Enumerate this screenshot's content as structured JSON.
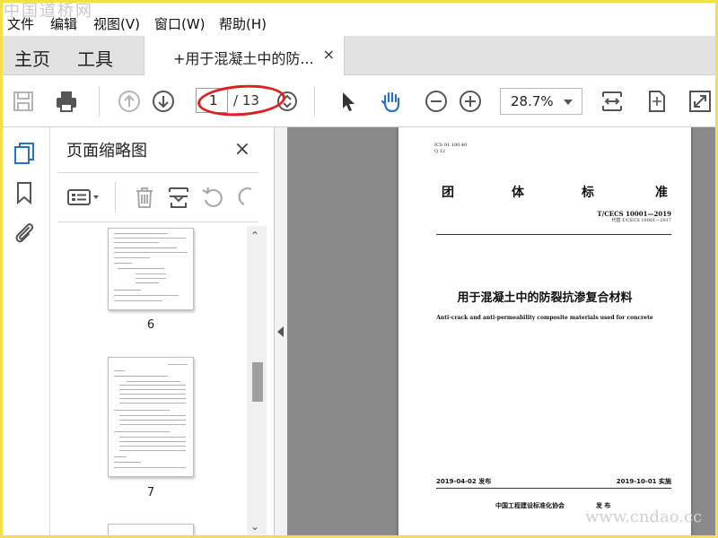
{
  "watermark": {
    "top_left": "中国道桥网",
    "bottom_right": "www.cndao.cc"
  },
  "menubar": {
    "items": [
      "文件",
      "编辑",
      "视图(V)",
      "窗口(W)",
      "帮助(H)"
    ]
  },
  "tabs": {
    "home": "主页",
    "tools": "工具",
    "document": "+用于混凝土中的防...",
    "close": "×"
  },
  "toolbar": {
    "current_page": "1",
    "page_total": "/ 13",
    "zoom": "28.7%",
    "annotation": "red oval around page number",
    "icons": [
      "save-icon",
      "print-icon",
      "prev-page-icon",
      "next-page-icon",
      "page-scroll-icon",
      "select-cursor-icon",
      "hand-tool-icon",
      "zoom-out-icon",
      "zoom-in-icon",
      "fit-width-icon",
      "fit-page-icon",
      "fullscreen-icon"
    ]
  },
  "left_rail": {
    "icons": [
      "pages-icon",
      "bookmark-icon",
      "attachment-icon"
    ]
  },
  "thumbnail_panel": {
    "title": "页面缩略图",
    "close": "×",
    "tools": [
      "options-icon",
      "delete-icon",
      "insert-page-icon",
      "rotate-ccw-icon",
      "rotate-cw-icon"
    ],
    "pages": [
      {
        "label": "6"
      },
      {
        "label": "7"
      }
    ]
  },
  "document": {
    "ics": "ICS 91.100.40",
    "q": "Q 12",
    "standard_type": [
      "团",
      "体",
      "标",
      "准"
    ],
    "standard_number": "T/CECS 10001—2019",
    "replaces": "代替 T/CECS 10001—2017",
    "title_cn": "用于混凝土中的防裂抗渗复合材料",
    "title_en": "Anti-crack and anti-permeability composite materials used for concrete",
    "issue_date": "2019-04-02 发布",
    "effective_date": "2019-10-01 实施",
    "publisher": "中国工程建设标准化协会",
    "publish_word": "发 布"
  },
  "colors": {
    "accent": "#2a6fc9",
    "annotation": "#e02020",
    "frame": "#f0e14a"
  }
}
